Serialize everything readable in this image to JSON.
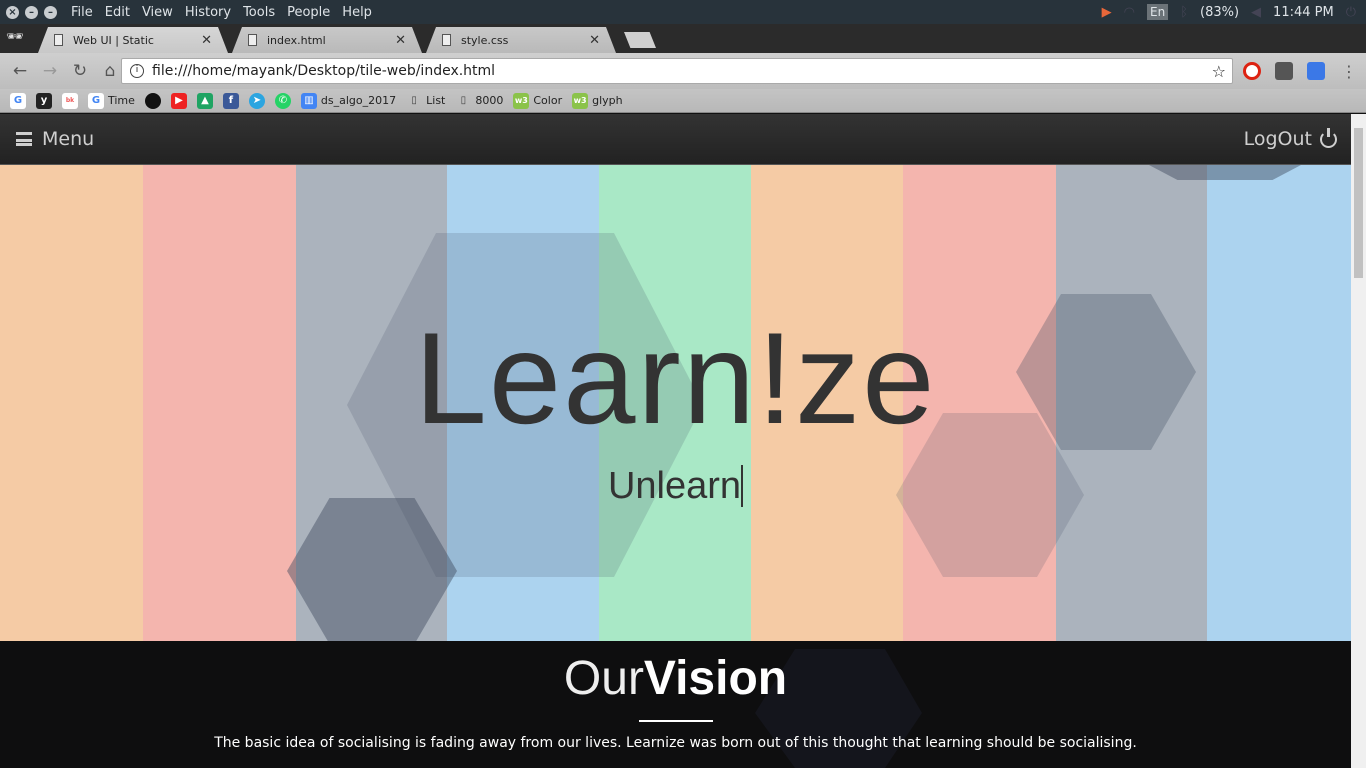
{
  "system": {
    "menu": [
      "File",
      "Edit",
      "View",
      "History",
      "Tools",
      "People",
      "Help"
    ],
    "lang": "En",
    "battery": "(83%)",
    "time": "11:44 PM"
  },
  "tabs": [
    {
      "label": "Web UI | Static"
    },
    {
      "label": "index.html"
    },
    {
      "label": "style.css"
    }
  ],
  "address": {
    "url": "file:///home/mayank/Desktop/tile-web/index.html"
  },
  "bookmarks": [
    {
      "label": "",
      "icon": "google-icon"
    },
    {
      "label": "",
      "icon": "bookmark-icon"
    },
    {
      "label": "",
      "icon": "backpack-icon"
    },
    {
      "label": "Time",
      "icon": "google-icon"
    },
    {
      "label": "",
      "icon": "github-icon"
    },
    {
      "label": "",
      "icon": "youtube-icon"
    },
    {
      "label": "",
      "icon": "drive-icon"
    },
    {
      "label": "",
      "icon": "facebook-icon"
    },
    {
      "label": "",
      "icon": "telegram-icon"
    },
    {
      "label": "",
      "icon": "whatsapp-icon"
    },
    {
      "label": "ds_algo_2017",
      "icon": "docs-icon"
    },
    {
      "label": "List",
      "icon": "page-icon"
    },
    {
      "label": "8000",
      "icon": "page-icon"
    },
    {
      "label": "Color",
      "icon": "w3-icon"
    },
    {
      "label": "glyph",
      "icon": "w3-icon"
    }
  ],
  "site": {
    "menu_label": "Menu",
    "logout_label": "LogOut",
    "title": "Learn!ze",
    "subtitle": "Unlearn",
    "vision_light": "Our",
    "vision_bold": "Vision",
    "vision_text": "The basic idea of socialising is fading away from our lives. Learnize was born out of this thought that learning should be socialising."
  },
  "colors": {
    "stripes": [
      "#f5cba5",
      "#f4b5ae",
      "#abb3bd",
      "#acd3ef",
      "#a9e8c6",
      "#f5cba5",
      "#f4b5ae",
      "#abb3bd",
      "#acd3ef"
    ]
  }
}
